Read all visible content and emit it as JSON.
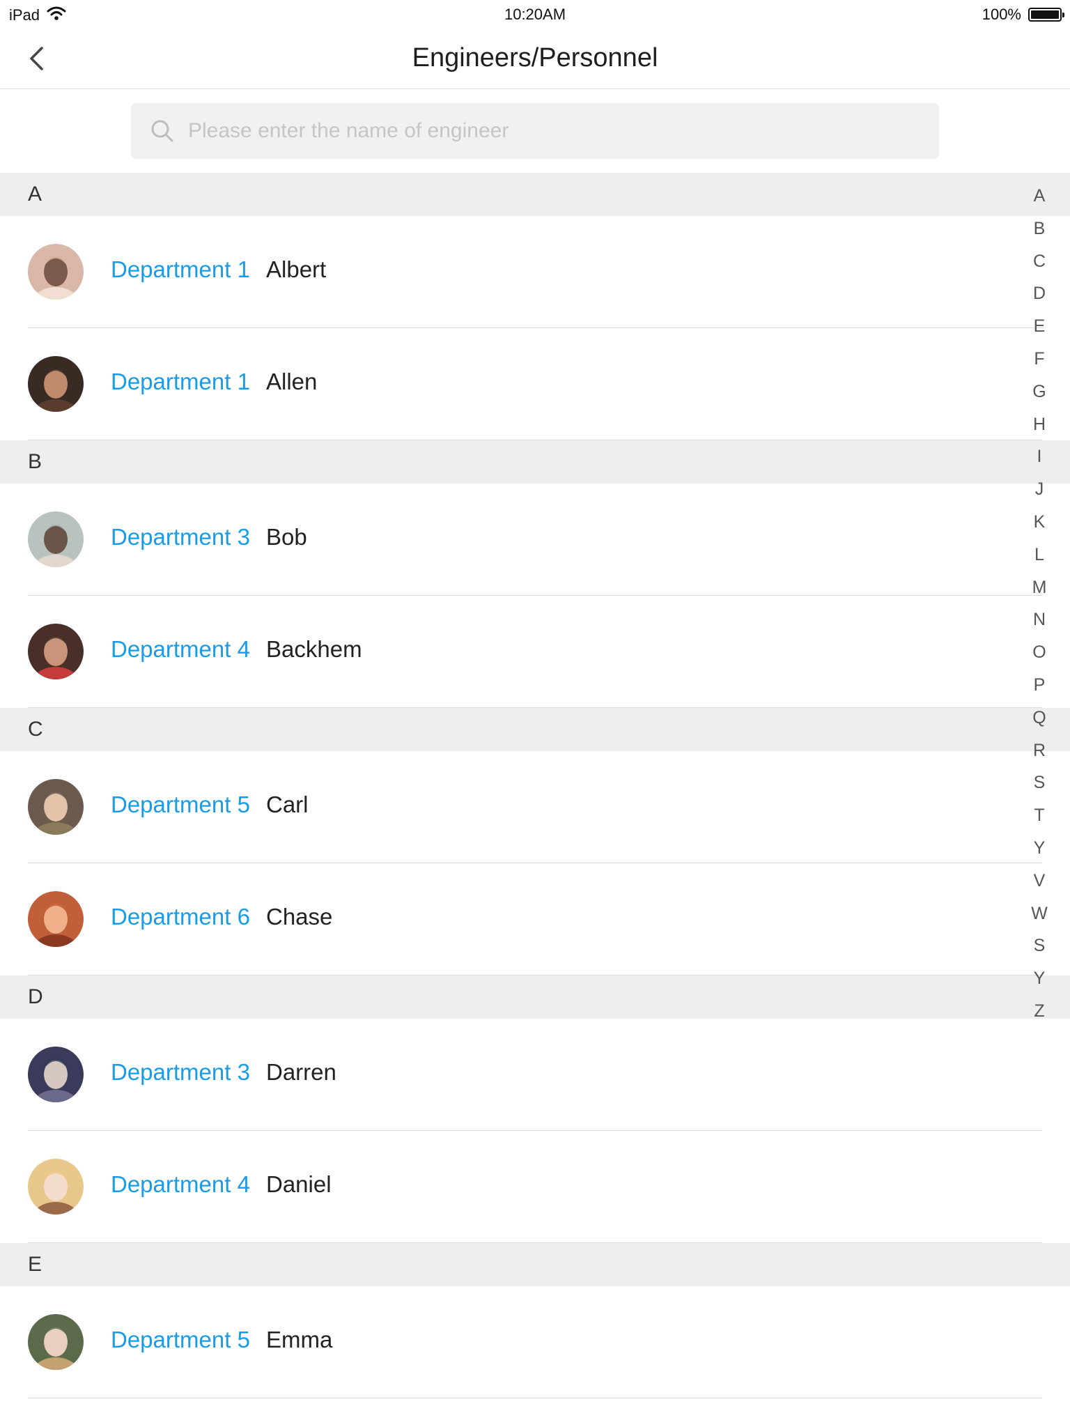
{
  "status_bar": {
    "device": "iPad",
    "time": "10:20AM",
    "battery": "100%",
    "battery_level": 1.0
  },
  "nav": {
    "title": "Engineers/Personnel"
  },
  "search": {
    "placeholder": "Please enter the name of engineer",
    "value": ""
  },
  "sections": [
    {
      "letter": "A",
      "items": [
        {
          "department": "Department 1",
          "name": "Albert"
        },
        {
          "department": "Department 1",
          "name": "Allen"
        }
      ]
    },
    {
      "letter": "B",
      "items": [
        {
          "department": "Department 3",
          "name": "Bob"
        },
        {
          "department": "Department 4",
          "name": "Backhem"
        }
      ]
    },
    {
      "letter": "C",
      "items": [
        {
          "department": "Department 5",
          "name": "Carl"
        },
        {
          "department": "Department 6",
          "name": "Chase"
        }
      ]
    },
    {
      "letter": "D",
      "items": [
        {
          "department": "Department 3",
          "name": "Darren"
        },
        {
          "department": "Department 4",
          "name": "Daniel"
        }
      ]
    },
    {
      "letter": "E",
      "items": [
        {
          "department": "Department 5",
          "name": "Emma"
        }
      ]
    }
  ],
  "alphabet_index": [
    "A",
    "B",
    "C",
    "D",
    "E",
    "F",
    "G",
    "H",
    "I",
    "J",
    "K",
    "L",
    "M",
    "N",
    "O",
    "P",
    "Q",
    "R",
    "S",
    "T",
    "Y",
    "V",
    "W",
    "S",
    "Y",
    "Z"
  ],
  "colors": {
    "accent": "#1a9be6",
    "section_bg": "#eeeeee",
    "search_bg": "#f1f1f1"
  }
}
